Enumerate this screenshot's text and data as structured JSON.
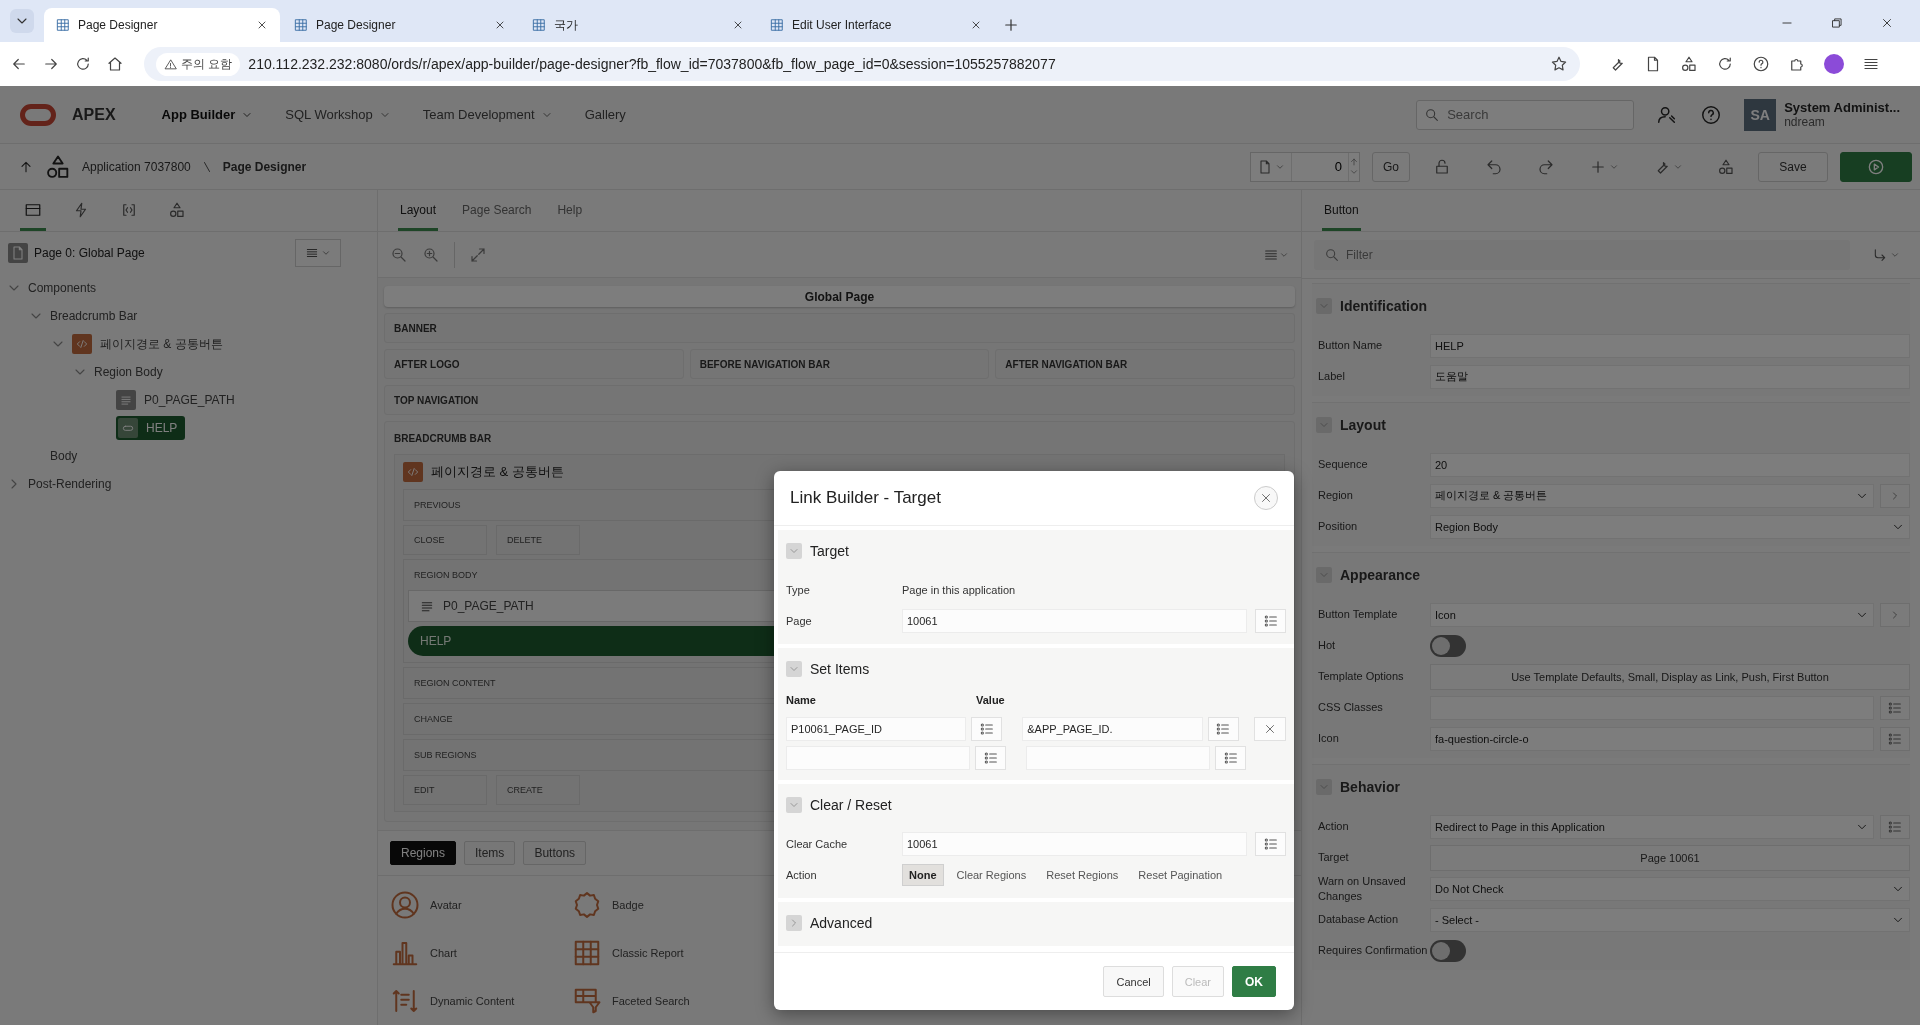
{
  "browser": {
    "tabs": [
      {
        "title": "Page Designer",
        "selected": true
      },
      {
        "title": "Page Designer",
        "selected": false
      },
      {
        "title": "국가",
        "selected": false
      },
      {
        "title": "Edit User Interface",
        "selected": false
      }
    ],
    "security_label": "주의 요함",
    "url": "210.112.232.232:8080/ords/r/apex/app-builder/page-designer?fb_flow_id=7037800&fb_flow_page_id=0&session=1055257882077"
  },
  "app_header": {
    "logo": "APEX",
    "menu": [
      {
        "label": "App Builder",
        "selected": true,
        "dropdown": true
      },
      {
        "label": "SQL Workshop",
        "selected": false,
        "dropdown": true
      },
      {
        "label": "Team Development",
        "selected": false,
        "dropdown": true
      },
      {
        "label": "Gallery",
        "selected": false,
        "dropdown": false
      }
    ],
    "search": {
      "placeholder": "Search"
    },
    "user": {
      "initials": "SA",
      "name": "System Administ...",
      "workspace": "ndream"
    }
  },
  "toolbar": {
    "breadcrumb": [
      {
        "label": "Application 7037800"
      },
      {
        "label": "Page Designer"
      }
    ],
    "page_number": "0",
    "go_button": "Go",
    "save_button": "Save"
  },
  "left_panel": {
    "tabs": [
      {
        "kind": "rendering",
        "selected": true
      },
      {
        "kind": "dynamic-actions",
        "selected": false
      },
      {
        "kind": "processing",
        "selected": false
      },
      {
        "kind": "shared",
        "selected": false
      }
    ],
    "page_title": "Page 0: Global Page",
    "tree": [
      {
        "label": "Components",
        "expanded": true,
        "selected": false,
        "children": [
          {
            "label": "Breadcrumb Bar",
            "expanded": true,
            "selected": false,
            "children": [
              {
                "label": "페이지경로 & 공통버튼",
                "kind": "region",
                "expanded": true,
                "selected": false,
                "children": [
                  {
                    "label": "Region Body",
                    "expanded": true,
                    "selected": false,
                    "children": [
                      {
                        "label": "P0_PAGE_PATH",
                        "kind": "item",
                        "selected": false
                      },
                      {
                        "label": "HELP",
                        "kind": "button",
                        "selected": true
                      }
                    ]
                  }
                ]
              }
            ]
          },
          {
            "label": "Body",
            "selected": false
          }
        ]
      },
      {
        "label": "Post-Rendering",
        "expanded": false,
        "selected": false
      }
    ]
  },
  "layout_panel": {
    "tabs": [
      {
        "label": "Layout",
        "selected": true
      },
      {
        "label": "Page Search",
        "selected": false
      },
      {
        "label": "Help",
        "selected": false
      }
    ],
    "page_title": "Global Page",
    "rows": [
      [
        {
          "label": "BANNER"
        }
      ],
      [
        {
          "label": "AFTER LOGO"
        },
        {
          "label": "BEFORE NAVIGATION BAR"
        },
        {
          "label": "AFTER NAVIGATION BAR"
        }
      ],
      [
        {
          "label": "TOP NAVIGATION"
        }
      ]
    ],
    "breadcrumb_bar": {
      "label": "BREADCRUMB BAR",
      "region": {
        "title": "페이지경로 & 공통버튼",
        "positions": [
          {
            "kind": "position",
            "label": "PREVIOUS"
          },
          {
            "kind": "slots",
            "slots": [
              "CLOSE",
              "DELETE"
            ]
          },
          {
            "kind": "position",
            "label": "REGION BODY",
            "components": [
              {
                "kind": "item",
                "label": "P0_PAGE_PATH",
                "selected": false
              },
              {
                "kind": "button",
                "label": "HELP",
                "selected": true
              }
            ]
          },
          {
            "kind": "position",
            "label": "REGION CONTENT"
          },
          {
            "kind": "position",
            "label": "CHANGE"
          },
          {
            "kind": "position",
            "label": "SUB REGIONS"
          },
          {
            "kind": "slots",
            "slots": [
              "EDIT",
              "CREATE"
            ]
          }
        ]
      }
    },
    "gallery": {
      "tabs": [
        {
          "label": "Regions",
          "selected": true
        },
        {
          "label": "Items",
          "selected": false
        },
        {
          "label": "Buttons",
          "selected": false
        }
      ],
      "items": [
        {
          "label": "Avatar",
          "kind": "avatar"
        },
        {
          "label": "Badge",
          "kind": "badge"
        },
        {
          "label": "Chart",
          "kind": "chart"
        },
        {
          "label": "Classic Report",
          "kind": "report"
        },
        {
          "label": "Dynamic Content",
          "kind": "dynamic"
        },
        {
          "label": "Faceted Search",
          "kind": "faceted"
        }
      ]
    }
  },
  "property_panel": {
    "tab": "Button",
    "filter": {
      "placeholder": "Filter"
    },
    "sections": [
      {
        "title": "Identification",
        "expanded": true,
        "properties": [
          {
            "label": "Button Name",
            "kind": "text",
            "value": "HELP"
          },
          {
            "label": "Label",
            "kind": "text",
            "value": "도움말"
          }
        ]
      },
      {
        "title": "Layout",
        "expanded": true,
        "properties": [
          {
            "label": "Sequence",
            "kind": "text",
            "value": "20"
          },
          {
            "label": "Region",
            "kind": "select",
            "value": "페이지경로 & 공통버튼",
            "goto_button": true
          },
          {
            "label": "Position",
            "kind": "select",
            "value": "Region Body"
          }
        ]
      },
      {
        "title": "Appearance",
        "expanded": true,
        "properties": [
          {
            "label": "Button Template",
            "kind": "select",
            "value": "Icon",
            "goto_button": true
          },
          {
            "label": "Hot",
            "kind": "switch",
            "on": false
          },
          {
            "label": "Template Options",
            "kind": "button",
            "value": "Use Template Defaults, Small, Display as Link, Push, First Button"
          },
          {
            "label": "CSS Classes",
            "kind": "text",
            "list_button": true
          },
          {
            "label": "Icon",
            "kind": "text",
            "value": "fa-question-circle-o",
            "list_button": true
          }
        ]
      },
      {
        "title": "Behavior",
        "expanded": true,
        "properties": [
          {
            "label": "Action",
            "kind": "select",
            "value": "Redirect to Page in this Application",
            "list_button": true
          },
          {
            "label": "Target",
            "kind": "button",
            "value": "Page 10061"
          },
          {
            "label": "Warn on Unsaved Changes",
            "kind": "select",
            "value": "Do Not Check"
          },
          {
            "label": "Database Action",
            "kind": "select",
            "value": "- Select -"
          },
          {
            "label": "Requires Confirmation",
            "kind": "switch",
            "on": false
          }
        ]
      }
    ]
  },
  "dialog": {
    "title": "Link Builder - Target",
    "target": {
      "title": "Target",
      "expanded": true,
      "type_label": "Type",
      "type_value": "Page in this application",
      "page_label": "Page",
      "page_value": "10061"
    },
    "set_items": {
      "title": "Set Items",
      "expanded": true,
      "name_header": "Name",
      "value_header": "Value",
      "rows": [
        {
          "name": "P10061_PAGE_ID",
          "value": "&APP_PAGE_ID.",
          "removable": true
        },
        {
          "removable": false
        }
      ]
    },
    "clear_reset": {
      "title": "Clear / Reset",
      "expanded": true,
      "cache_label": "Clear Cache",
      "cache_value": "10061",
      "action_label": "Action",
      "actions": [
        {
          "label": "None",
          "selected": true
        },
        {
          "label": "Clear Regions",
          "selected": false
        },
        {
          "label": "Reset Regions",
          "selected": false
        },
        {
          "label": "Reset Pagination",
          "selected": false
        }
      ]
    },
    "advanced": {
      "title": "Advanced",
      "expanded": false
    },
    "buttons": [
      {
        "label": "Cancel",
        "kind": "default",
        "disabled": false
      },
      {
        "label": "Clear",
        "kind": "default",
        "disabled": true
      },
      {
        "label": "OK",
        "kind": "primary",
        "disabled": false
      }
    ]
  }
}
